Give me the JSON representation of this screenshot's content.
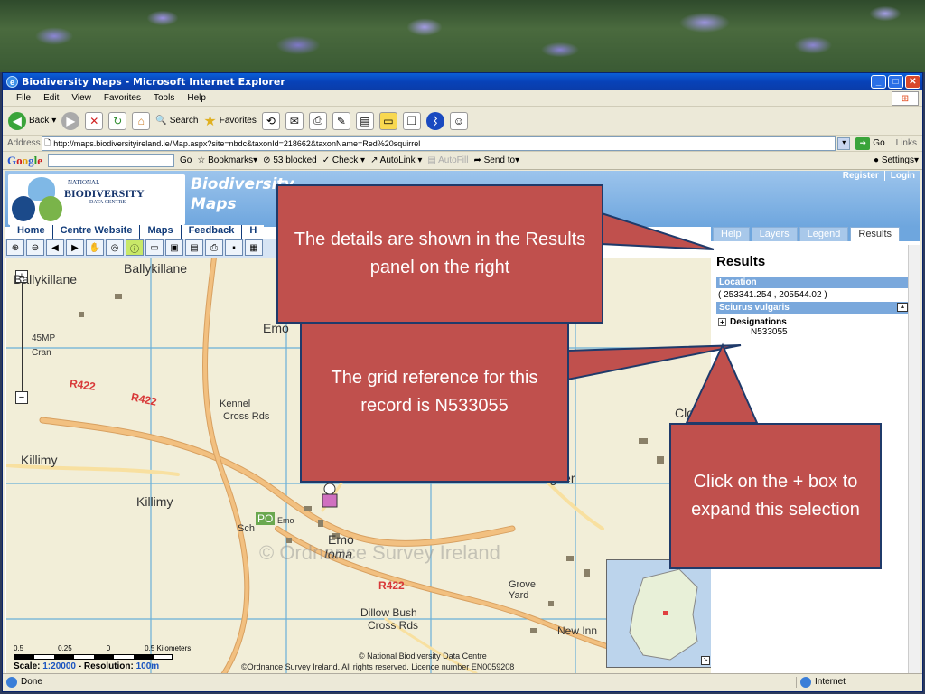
{
  "window": {
    "title": "Biodiversity Maps - Microsoft Internet Explorer",
    "menu": [
      "File",
      "Edit",
      "View",
      "Favorites",
      "Tools",
      "Help"
    ],
    "toolbar": {
      "back": "Back",
      "search": "Search",
      "favorites": "Favorites"
    },
    "address_label": "Address",
    "address_url": "http://maps.biodiversityireland.ie/Map.aspx?site=nbdc&taxonId=218662&taxonName=Red%20squirrel",
    "go_label": "Go",
    "links_label": "Links",
    "google": {
      "logo": "Google",
      "go": "Go",
      "bookmarks": "Bookmarks",
      "blocked": "53 blocked",
      "check": "Check",
      "autolink": "AutoLink",
      "autofill": "AutoFill",
      "sendto": "Send to",
      "settings": "Settings"
    },
    "status_left": "Done",
    "status_right": "Internet"
  },
  "site": {
    "logo": {
      "national": "NATIONAL",
      "biodiversity": "BIODIVERSITY",
      "data_centre": "DATA CENTRE"
    },
    "title_line1": "Biodiversity",
    "title_line2": "Maps",
    "register": "Register",
    "login": "Login",
    "nav": [
      "Home",
      "Centre Website",
      "Maps",
      "Feedback",
      "H"
    ]
  },
  "map": {
    "labels": {
      "ballykillane": "Ballykillane",
      "ballykillane2": "Ballykillane",
      "emo": "Emo",
      "killimy1": "Killimy",
      "killimy2": "Killimy",
      "kennel": "Kennel",
      "cross_rds": "Cross Rds",
      "r422a": "R422",
      "r422b": "R422",
      "r422c": "R422",
      "killeenatogher": "Killeenatogher",
      "po": "PO",
      "po_emo": "Emo",
      "sch": "Sch",
      "emo2": "Emo",
      "ioma": "Ioma",
      "grove": "Grove",
      "yard": "Yard",
      "dillow": "Dillow Bush",
      "cross_rds2": "Cross Rds",
      "new_inn": "New Inn",
      "clon": "Clon",
      "m45": "45MP",
      "cran": "Cran"
    },
    "watermark": "© Ordnance Survey Ireland",
    "scale_ticks": [
      "0.5",
      "0.25",
      "0",
      "0.5 Kilometers"
    ],
    "scale_label": "Scale:",
    "scale_value": "1:20000",
    "resolution_label": "- Resolution:",
    "resolution_value": "100m",
    "copyright_nbdc": "© National Biodiversity Data Centre",
    "copyright_osi": "©Ordnance Survey Ireland. All rights reserved. Licence number EN0059208"
  },
  "panel": {
    "tabs": [
      "Help",
      "Layers",
      "Legend",
      "Results"
    ],
    "results_title": "Results",
    "location_head": "Location",
    "location_value": "( 253341.254 , 205544.02 )",
    "species_head": "Sciurus vulgaris",
    "designations": "Designations",
    "grid_ref": "N533055"
  },
  "callouts": {
    "c1": "The details are shown in the Results panel on the right",
    "c2": "The grid reference for this record is  N533055",
    "c3": "Click on the + box to expand this selection"
  },
  "colors": {
    "callout": "#c0504d",
    "callout_border": "#1f3a6a",
    "section_head": "#7aa8dc"
  }
}
